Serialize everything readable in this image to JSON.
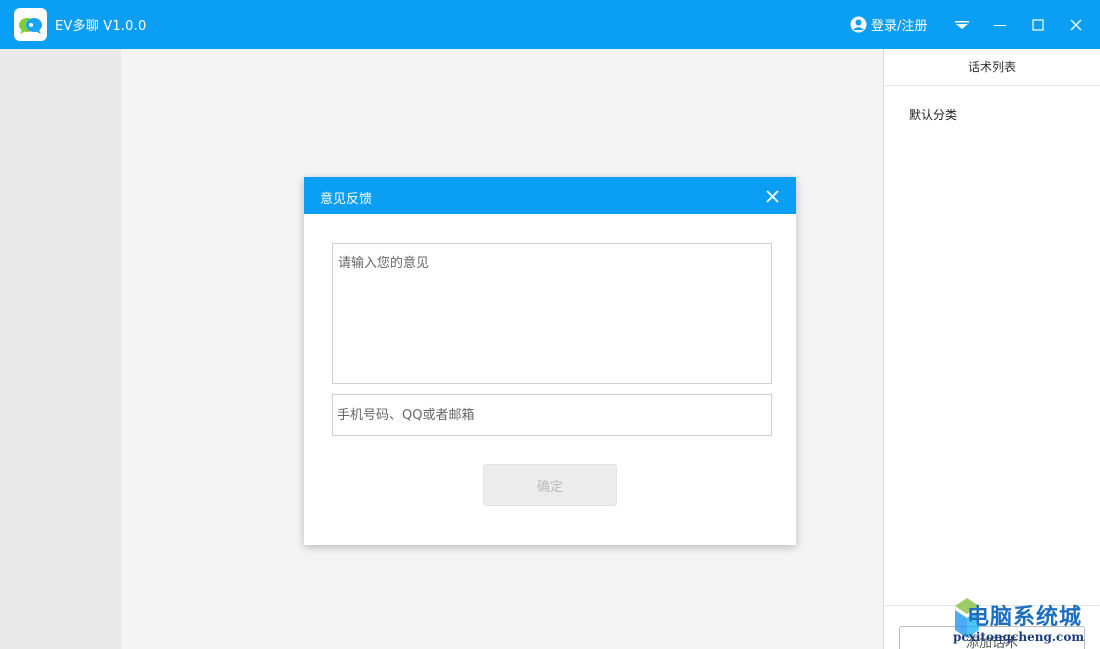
{
  "app": {
    "name": "EV多聊  V1.0.0",
    "accent_color": "#0a9ef5",
    "logo_icon": "chat-bubbles-icon"
  },
  "titlebar": {
    "login_label": "登录/注册",
    "user_icon": "user-circle-icon",
    "menu_icon": "dropdown-menu-icon",
    "minimize_icon": "minimize-icon",
    "maximize_icon": "maximize-icon",
    "close_icon": "close-icon"
  },
  "right_panel": {
    "header": "话术列表",
    "categories": [
      "默认分类"
    ],
    "add_button_label": "添加话术"
  },
  "dialog": {
    "title": "意见反馈",
    "close_icon": "close-icon",
    "feedback_placeholder": "请输入您的意见",
    "feedback_value": "",
    "contact_placeholder": "手机号码、QQ或者邮箱",
    "contact_value": "",
    "confirm_label": "确定"
  },
  "watermark": {
    "text": "电脑系统城",
    "url": "pcxitongcheng.com"
  }
}
